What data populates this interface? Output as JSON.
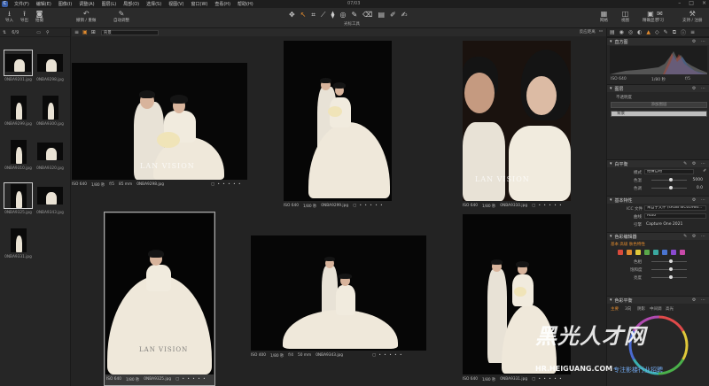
{
  "app": {
    "window_title": "07/03",
    "menu": [
      "文件(F)",
      "编辑(E)",
      "图像(I)",
      "调整(A)",
      "图层(L)",
      "局部(O)",
      "选择(S)",
      "视图(V)",
      "窗口(W)",
      "查看(H)",
      "帮助(H)"
    ]
  },
  "toolbar": {
    "left_buttons": [
      {
        "icon": "import-icon",
        "glyph": "⭳",
        "label": "导入"
      },
      {
        "icon": "export-icon",
        "glyph": "⭱",
        "label": "导出"
      },
      {
        "icon": "camera-icon",
        "glyph": "◙",
        "label": "拍摄"
      },
      {
        "icon": "undo-icon",
        "glyph": "↶",
        "label": "撤销 / 重做"
      },
      {
        "icon": "auto-adjust-icon",
        "glyph": "✎",
        "label": "自动调整"
      }
    ],
    "cursor_tools_label": "光标工具",
    "right_buttons": [
      {
        "icon": "grid-icon",
        "glyph": "▦",
        "label": "网格"
      },
      {
        "icon": "before-after-icon",
        "glyph": "◫",
        "label": "视图"
      },
      {
        "icon": "proof-icon",
        "glyph": "▣",
        "label": "精确显示"
      },
      {
        "icon": "learn-icon",
        "glyph": "✉",
        "label": "学习"
      },
      {
        "icon": "settings-icon",
        "glyph": "⚒",
        "label": "支持 / 注册"
      }
    ]
  },
  "browser": {
    "count": "6/9",
    "thumbs": [
      {
        "name": "0NBA9201.jpg",
        "orient": "land",
        "selected": true
      },
      {
        "name": "0NBA9298.jpg",
        "orient": "land",
        "selected": false
      },
      {
        "name": "0NBA9299.jpg",
        "orient": "port",
        "selected": false
      },
      {
        "name": "0NBA9300.jpg",
        "orient": "port",
        "selected": false
      },
      {
        "name": "0NBA9310.jpg",
        "orient": "port",
        "selected": false
      },
      {
        "name": "0NBA9320.jpg",
        "orient": "land",
        "selected": false
      },
      {
        "name": "0NBA9325.jpg",
        "orient": "port",
        "selected": true
      },
      {
        "name": "0NBA9343.jpg",
        "orient": "land",
        "selected": false
      },
      {
        "name": "0NBA9331.jpg",
        "orient": "port",
        "selected": false
      }
    ]
  },
  "viewer": {
    "select_value": "背景",
    "right_label": "反应距离",
    "photos": [
      {
        "iso": "ISO 640",
        "shutter": "1/80 秒",
        "aperture": "f/5",
        "focal": "85 mm",
        "name": "0NBA9298.jpg",
        "watermark": "LAN VISION"
      },
      {
        "iso": "ISO 640",
        "shutter": "1/80 秒",
        "aperture": "",
        "focal": "",
        "name": "0NBA9299.jpg",
        "watermark": ""
      },
      {
        "iso": "ISO 640",
        "shutter": "1/80 秒",
        "aperture": "",
        "focal": "",
        "name": "0NBA9310.jpg",
        "watermark": "LAN VISION"
      },
      {
        "iso": "ISO 640",
        "shutter": "1/80 秒",
        "aperture": "",
        "focal": "",
        "name": "0NBA9325.jpg",
        "watermark": "LAN VISION"
      },
      {
        "iso": "ISO 400",
        "shutter": "1/80 秒",
        "aperture": "f/4",
        "focal": "50 mm",
        "name": "0NBA9343.jpg",
        "watermark": ""
      },
      {
        "iso": "ISO 640",
        "shutter": "1/80 秒",
        "aperture": "",
        "focal": "",
        "name": "0NBA9331.jpg",
        "watermark": ""
      }
    ]
  },
  "adjust": {
    "histogram_title": "直方图",
    "histogram_readout": {
      "iso": "ISO 640",
      "shutter": "1/80 秒",
      "aperture": "f/5"
    },
    "layers_title": "图层",
    "layers_opacity_label": "不透明度",
    "layers_add_label": "添加图层",
    "layers_bg": "背景",
    "wb_title": "白平衡",
    "wb_mode_label": "模式",
    "wb_mode_value": "拍摄自相",
    "wb_kelvin_label": "色温",
    "wb_kelvin_value": "5000",
    "wb_tint_label": "色调",
    "wb_tint_value": "0.0",
    "base_title": "基本特性",
    "icc_label": "ICC 文件",
    "icc_value": "来自于文件 (sRGB IEC61966...",
    "curve_label": "曲线",
    "curve_value": "Auto",
    "engine_label": "引擎",
    "engine_value": "Capture One 2021",
    "color_title": "色彩编辑器",
    "color_tabs": "基本  高级  肤色特性",
    "swatch_colors": [
      "#d94a3b",
      "#e08a2e",
      "#e0c83a",
      "#5aa84a",
      "#3aa8a0",
      "#4a74d0",
      "#8a4ad0",
      "#c84aa8"
    ],
    "hue_label": "色相",
    "sat_label": "饱和度",
    "light_label": "亮度",
    "balance_title": "色彩平衡",
    "balance_tabs": [
      "主要",
      "3向",
      "阴影",
      "中间调",
      "高光"
    ]
  },
  "site_watermark": {
    "name": "黑光人才网",
    "url": "HR.HEIGUANG.COM",
    "slogan": "专注影楼行业招聘"
  }
}
